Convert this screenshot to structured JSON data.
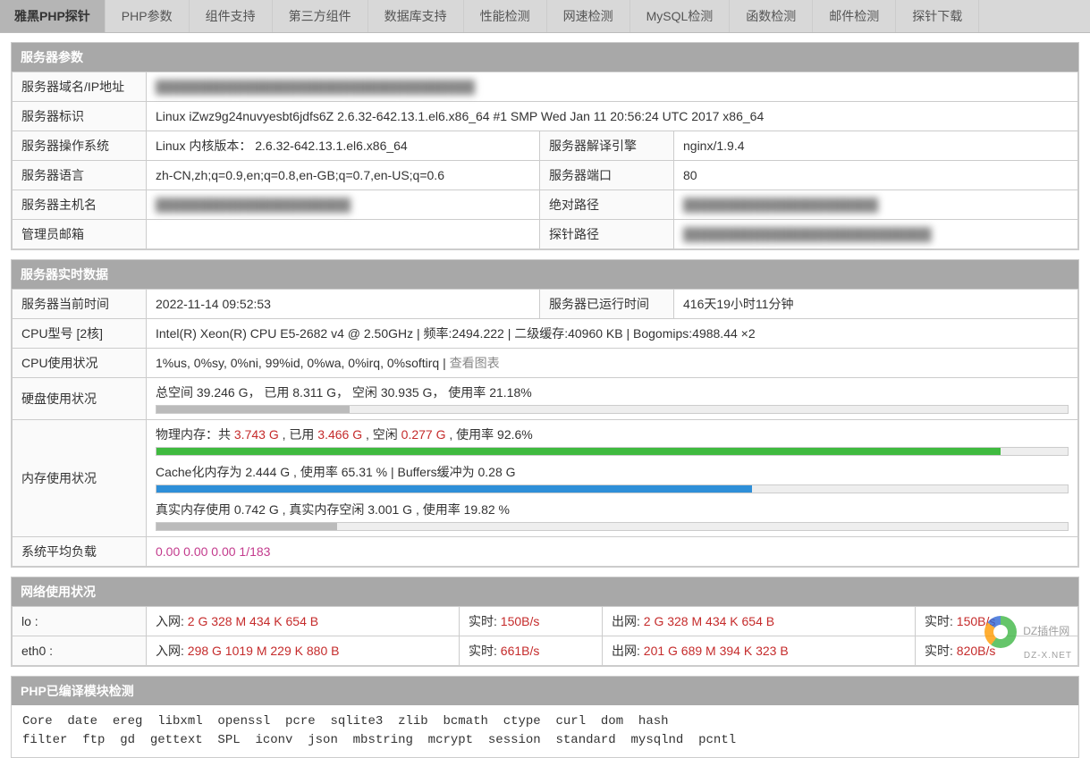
{
  "nav": {
    "title": "雅黑PHP探针",
    "items": [
      "PHP参数",
      "组件支持",
      "第三方组件",
      "数据库支持",
      "性能检测",
      "网速检测",
      "MySQL检测",
      "函数检测",
      "邮件检测",
      "探针下载"
    ]
  },
  "server_params": {
    "header": "服务器参数",
    "rows": {
      "domain_label": "服务器域名/IP地址",
      "domain_value": "████████████████████████████████████",
      "ident_label": "服务器标识",
      "ident_value": "Linux iZwz9g24nuvyesbt6jdfs6Z 2.6.32-642.13.1.el6.x86_64 #1 SMP Wed Jan 11 20:56:24 UTC 2017 x86_64",
      "os_label": "服务器操作系统",
      "os_value": "Linux  内核版本：  2.6.32-642.13.1.el6.x86_64",
      "engine_label": "服务器解译引擎",
      "engine_value": "nginx/1.9.4",
      "lang_label": "服务器语言",
      "lang_value": "zh-CN,zh;q=0.9,en;q=0.8,en-GB;q=0.7,en-US;q=0.6",
      "port_label": "服务器端口",
      "port_value": "80",
      "host_label": "服务器主机名",
      "host_value": "██████████████████████",
      "abspath_label": "绝对路径",
      "abspath_value": "██████████████████████",
      "admin_label": "管理员邮箱",
      "admin_value": "",
      "probe_label": "探针路径",
      "probe_value": "████████████████████████████"
    }
  },
  "realtime": {
    "header": "服务器实时数据",
    "time_label": "服务器当前时间",
    "time_value": "2022-11-14 09:52:53",
    "uptime_label": "服务器已运行时间",
    "uptime_value": "416天19小时11分钟",
    "cpu_model_label": "CPU型号 [2核]",
    "cpu_model_value": "Intel(R) Xeon(R) CPU E5-2682 v4 @ 2.50GHz | 频率:2494.222 | 二级缓存:40960 KB | Bogomips:4988.44 ×2",
    "cpu_use_label": "CPU使用状况",
    "cpu_use_value": "1%us, 0%sy, 0%ni, 99%id, 0%wa, 0%irq, 0%softirq | ",
    "cpu_use_link": "查看图表",
    "disk_label": "硬盘使用状况",
    "disk_text": "总空间 39.246 G， 已用 8.311 G， 空闲 30.935 G， 使用率 21.18%",
    "disk_pct": 21.18,
    "mem_label": "内存使用状况",
    "mem_phys_prefix": "物理内存：共 ",
    "mem_phys_total": "3.743 G",
    "mem_phys_mid1": " , 已用 ",
    "mem_phys_used": "3.466 G",
    "mem_phys_mid2": " , 空闲 ",
    "mem_phys_free": "0.277 G",
    "mem_phys_suffix": " , 使用率 92.6%",
    "mem_phys_pct": 92.6,
    "mem_cache_text": "Cache化内存为 2.444 G , 使用率 65.31 % | Buffers缓冲为 0.28 G",
    "mem_cache_pct": 65.31,
    "mem_real_text": "真实内存使用 0.742 G , 真实内存空闲 3.001 G , 使用率 19.82 %",
    "mem_real_pct": 19.82,
    "load_label": "系统平均负载",
    "load_value": "0.00 0.00 0.00 1/183"
  },
  "network": {
    "header": "网络使用状况",
    "rows": [
      {
        "iface": "lo :",
        "in_label": "入网:",
        "in_value": "2 G 328 M 434 K 654 B",
        "in_rt_label": "实时:",
        "in_rt_value": "150B/s",
        "out_label": "出网:",
        "out_value": "2 G 328 M 434 K 654 B",
        "out_rt_label": "实时:",
        "out_rt_value": "150B/s"
      },
      {
        "iface": "eth0 :",
        "in_label": "入网:",
        "in_value": "298 G 1019 M 229 K 880 B",
        "in_rt_label": "实时:",
        "in_rt_value": "661B/s",
        "out_label": "出网:",
        "out_value": "201 G 689 M 394 K 323 B",
        "out_rt_label": "实时:",
        "out_rt_value": "820B/s"
      }
    ]
  },
  "modules": {
    "header": "PHP已编译模块检测",
    "line1": "Core  date  ereg  libxml  openssl  pcre  sqlite3  zlib  bcmath  ctype  curl  dom  hash",
    "line2": "filter  ftp  gd  gettext  SPL  iconv  json  mbstring  mcrypt  session  standard  mysqlnd  pcntl"
  },
  "watermark": {
    "text": "DZ插件网",
    "sub": "DZ-X.NET"
  }
}
